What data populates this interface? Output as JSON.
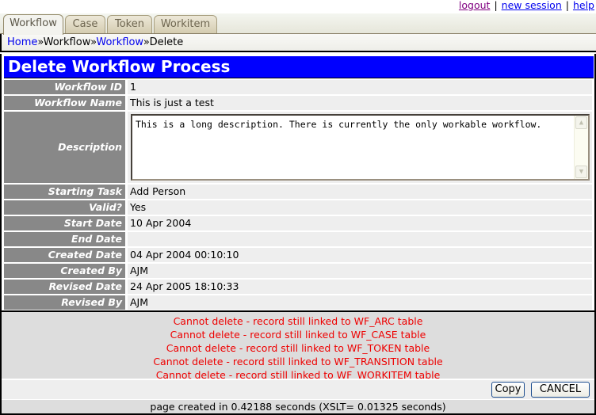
{
  "toplinks": {
    "logout": "logout",
    "new_session": "new session",
    "help": "help",
    "separator": "|"
  },
  "tabs": [
    {
      "label": "Workflow",
      "active": true
    },
    {
      "label": "Case",
      "active": false
    },
    {
      "label": "Token",
      "active": false
    },
    {
      "label": "Workitem",
      "active": false
    }
  ],
  "breadcrumb": {
    "items": [
      "Home",
      "Workflow",
      "Workflow",
      "Delete"
    ],
    "separator": "»"
  },
  "page_title": "Delete Workflow Process",
  "fields": {
    "workflow_id": {
      "label": "Workflow ID",
      "value": "1"
    },
    "workflow_name": {
      "label": "Workflow Name",
      "value": "This is just a test"
    },
    "description": {
      "label": "Description",
      "value": "This is a long description. There is currently the only workable workflow."
    },
    "starting_task": {
      "label": "Starting Task",
      "value": "Add Person"
    },
    "valid": {
      "label": "Valid?",
      "value": "Yes"
    },
    "start_date": {
      "label": "Start Date",
      "value": "10 Apr 2004"
    },
    "end_date": {
      "label": "End Date",
      "value": ""
    },
    "created_date": {
      "label": "Created Date",
      "value": "04 Apr 2004 00:10:10"
    },
    "created_by": {
      "label": "Created By",
      "value": "AJM"
    },
    "revised_date": {
      "label": "Revised Date",
      "value": "24 Apr 2005 18:10:33"
    },
    "revised_by": {
      "label": "Revised By",
      "value": "AJM"
    }
  },
  "messages": [
    "Cannot delete - record still linked to WF_ARC table",
    "Cannot delete - record still linked to WF_CASE table",
    "Cannot delete - record still linked to WF_TOKEN table",
    "Cannot delete - record still linked to WF_TRANSITION table",
    "Cannot delete - record still linked to WF_WORKITEM table"
  ],
  "buttons": {
    "copy": "Copy",
    "cancel": "CANCEL"
  },
  "footer": "page created in 0.42188 seconds (XSLT= 0.01325 seconds)",
  "colors": {
    "title_bg": "#0000ff",
    "label_bg": "#888888",
    "value_bg": "#eeeeee",
    "error": "#ee0000"
  }
}
